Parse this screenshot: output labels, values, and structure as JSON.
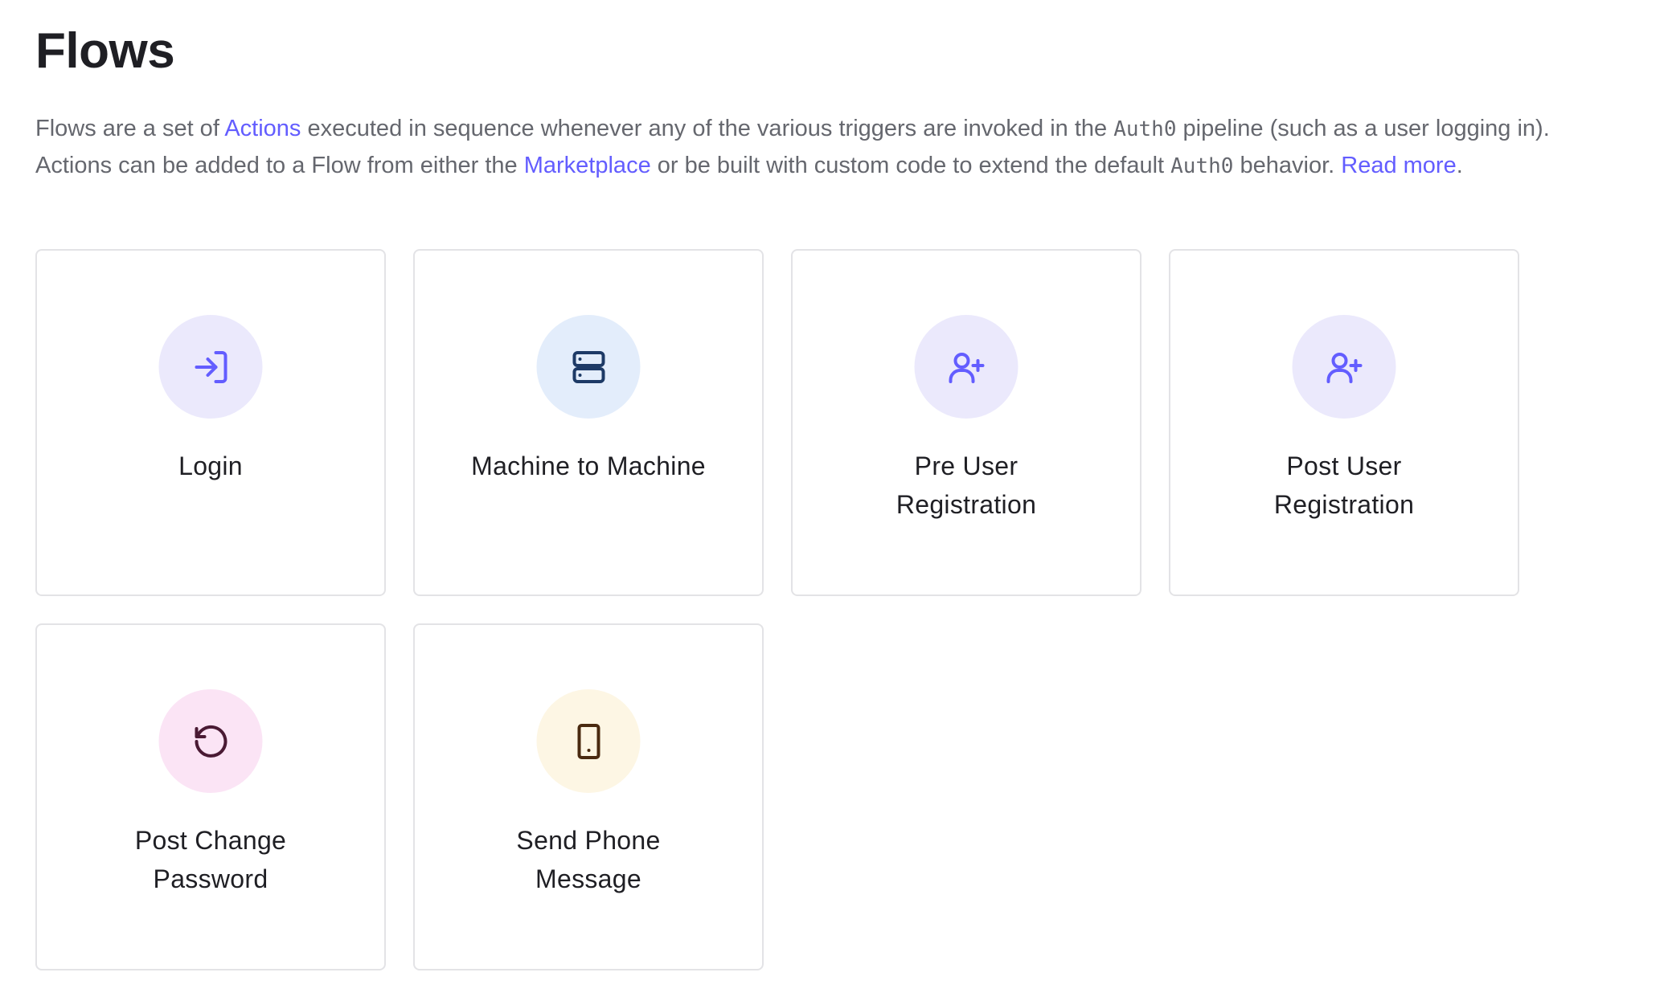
{
  "page": {
    "title": "Flows"
  },
  "intro": {
    "part1": "Flows are a set of ",
    "link_actions": "Actions",
    "part2": " executed in sequence whenever any of the various triggers are invoked in the ",
    "auth0_a": "Auth0",
    "part3": " pipeline (such as a user logging in).",
    "part4": "Actions can be added to a Flow from either the ",
    "link_marketplace": "Marketplace",
    "part5": " or be built with custom code to extend the default ",
    "auth0_b": "Auth0",
    "part6": " behavior. ",
    "link_read_more": "Read more",
    "part7": "."
  },
  "flows": [
    {
      "label": "Login",
      "icon": "login-arrow-icon",
      "bg": "#ebe9fc",
      "fg": "#635dff"
    },
    {
      "label": "Machine to Machine",
      "icon": "server-icon",
      "bg": "#e3edfb",
      "fg": "#1d3a66"
    },
    {
      "label": "Pre User Registration",
      "icon": "user-plus-icon",
      "bg": "#ebe9fc",
      "fg": "#635dff"
    },
    {
      "label": "Post User Registration",
      "icon": "user-plus-icon",
      "bg": "#ebe9fc",
      "fg": "#635dff"
    },
    {
      "label": "Post Change Password",
      "icon": "rotate-ccw-icon",
      "bg": "#fbe4f5",
      "fg": "#4a1a34"
    },
    {
      "label": "Send Phone Message",
      "icon": "tablet-icon",
      "bg": "#fdf6e4",
      "fg": "#4a2a10"
    }
  ]
}
